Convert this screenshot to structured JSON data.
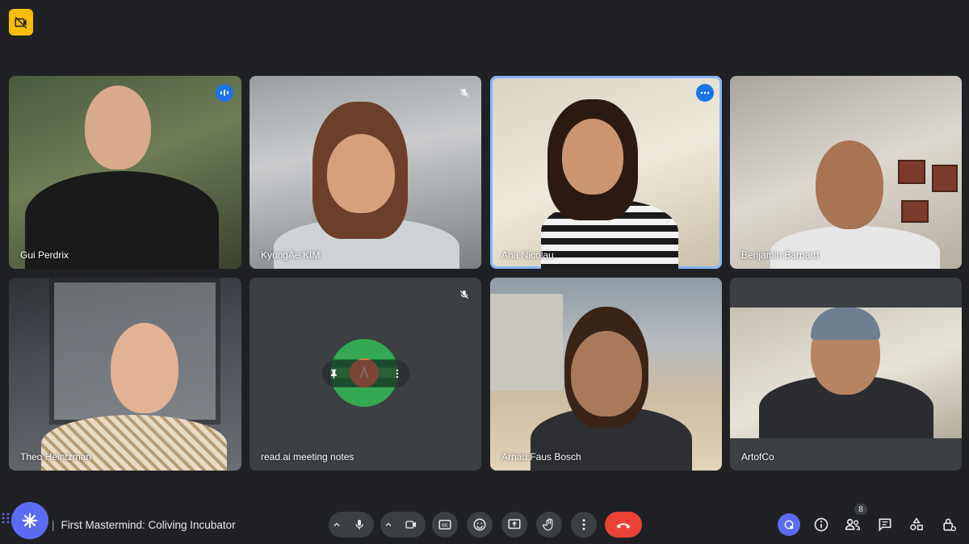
{
  "meeting": {
    "title": "First Mastermind: Coliving Incubator",
    "separator": "|",
    "participant_count": "8"
  },
  "participants": [
    {
      "name": "Gui Perdrix",
      "status": "speaking"
    },
    {
      "name": "KyungAe KIM",
      "status": "muted"
    },
    {
      "name": "Ana Nicolau",
      "status": "active"
    },
    {
      "name": "Benjamin Barnard",
      "status": ""
    },
    {
      "name": "Theo Heintzman",
      "status": ""
    },
    {
      "name": "read.ai meeting notes",
      "status": "muted"
    },
    {
      "name": "Arnau Faus Bosch",
      "status": ""
    },
    {
      "name": "ArtofCo",
      "status": ""
    }
  ],
  "colors": {
    "background": "#202124",
    "tile": "#3c4043",
    "accent": "#1a73e8",
    "active_border": "#8ab4f8",
    "end_call": "#ea4335",
    "badge": "#fbbc04",
    "app_logo": "#5c6bf4"
  },
  "icons": {
    "top_badge": "camera-off-icon",
    "controls": [
      "mic-icon",
      "camera-icon",
      "captions-icon",
      "emoji-icon",
      "present-icon",
      "raise-hand-icon",
      "more-options-icon",
      "end-call-icon"
    ],
    "right": [
      "activities-icon",
      "info-icon",
      "people-icon",
      "chat-icon",
      "shapes-icon",
      "host-controls-icon"
    ]
  }
}
